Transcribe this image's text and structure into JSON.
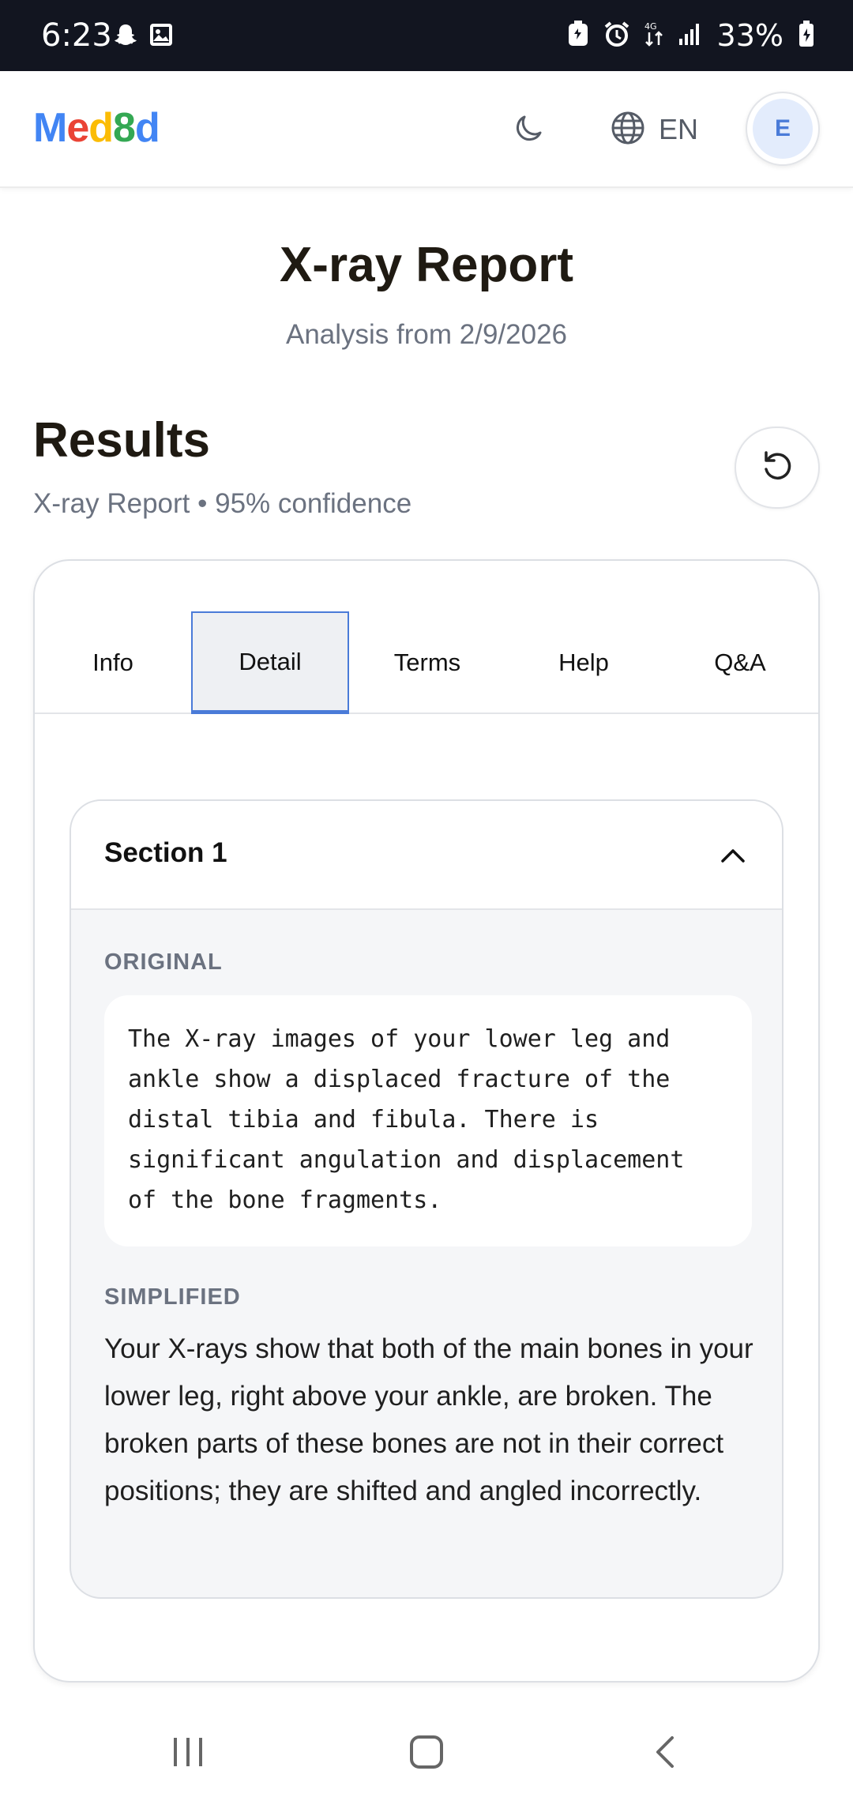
{
  "status_bar": {
    "time": "6:23",
    "battery": "33%",
    "icons": [
      "snapchat-icon",
      "gallery-icon",
      "battery-saver-icon",
      "alarm-icon",
      "data-icon",
      "signal-icon",
      "battery-icon"
    ]
  },
  "header": {
    "logo_letters": [
      "M",
      "e",
      "d",
      "8",
      "d"
    ],
    "language": "EN",
    "avatar_initial": "E"
  },
  "page": {
    "title": "X-ray Report",
    "subtitle": "Analysis from 2/9/2026"
  },
  "results": {
    "title": "Results",
    "meta": "X-ray Report • 95% confidence"
  },
  "tabs": [
    {
      "label": "Info",
      "active": false
    },
    {
      "label": "Detail",
      "active": true
    },
    {
      "label": "Terms",
      "active": false
    },
    {
      "label": "Help",
      "active": false
    },
    {
      "label": "Q&A",
      "active": false
    }
  ],
  "section": {
    "title": "Section 1",
    "original_label": "ORIGINAL",
    "original_text": "The X-ray images of your lower leg and\nankle show a displaced fracture of the\ndistal tibia and fibula. There is\nsignificant angulation and displacement\nof the bone fragments.",
    "simplified_label": "SIMPLIFIED",
    "simplified_text": "Your X-rays show that both of the main bones in your lower leg, right above your ankle, are broken. The broken parts of these bones are not in their correct positions; they are shifted and angled incorrectly."
  },
  "colors": {
    "accent": "#4a7bd8",
    "status_bar_bg": "#121520",
    "muted_text": "#6b7280"
  }
}
